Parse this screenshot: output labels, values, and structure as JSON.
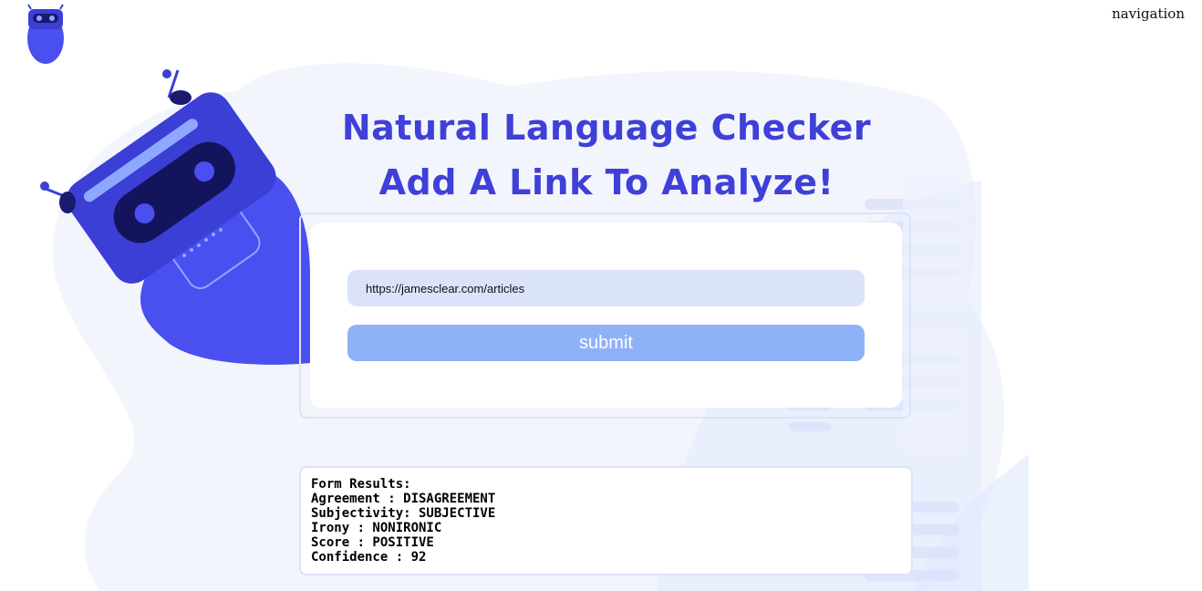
{
  "header": {
    "nav_link": "navigation"
  },
  "icons": {
    "logo": "robot-logo-icon",
    "illustration": "robot-illustration-icon"
  },
  "hero": {
    "title_line1": "Natural Language Checker",
    "title_line2": "Add A Link To Analyze!"
  },
  "form": {
    "url_value": "https://jamesclear.com/articles",
    "submit_label": "submit"
  },
  "results": {
    "heading": "Form Results:",
    "lines": [
      "Agreement : DISAGREEMENT",
      "Subjectivity: SUBJECTIVE",
      "Irony : NONIRONIC",
      "Score : POSITIVE",
      "Confidence : 92"
    ]
  },
  "colors": {
    "title": "#3f40d8",
    "input_bg": "#dbe3fb",
    "button_bg": "#8fb1f8",
    "blob": "#f3f5fd",
    "robot_body": "#4a4ff0"
  }
}
